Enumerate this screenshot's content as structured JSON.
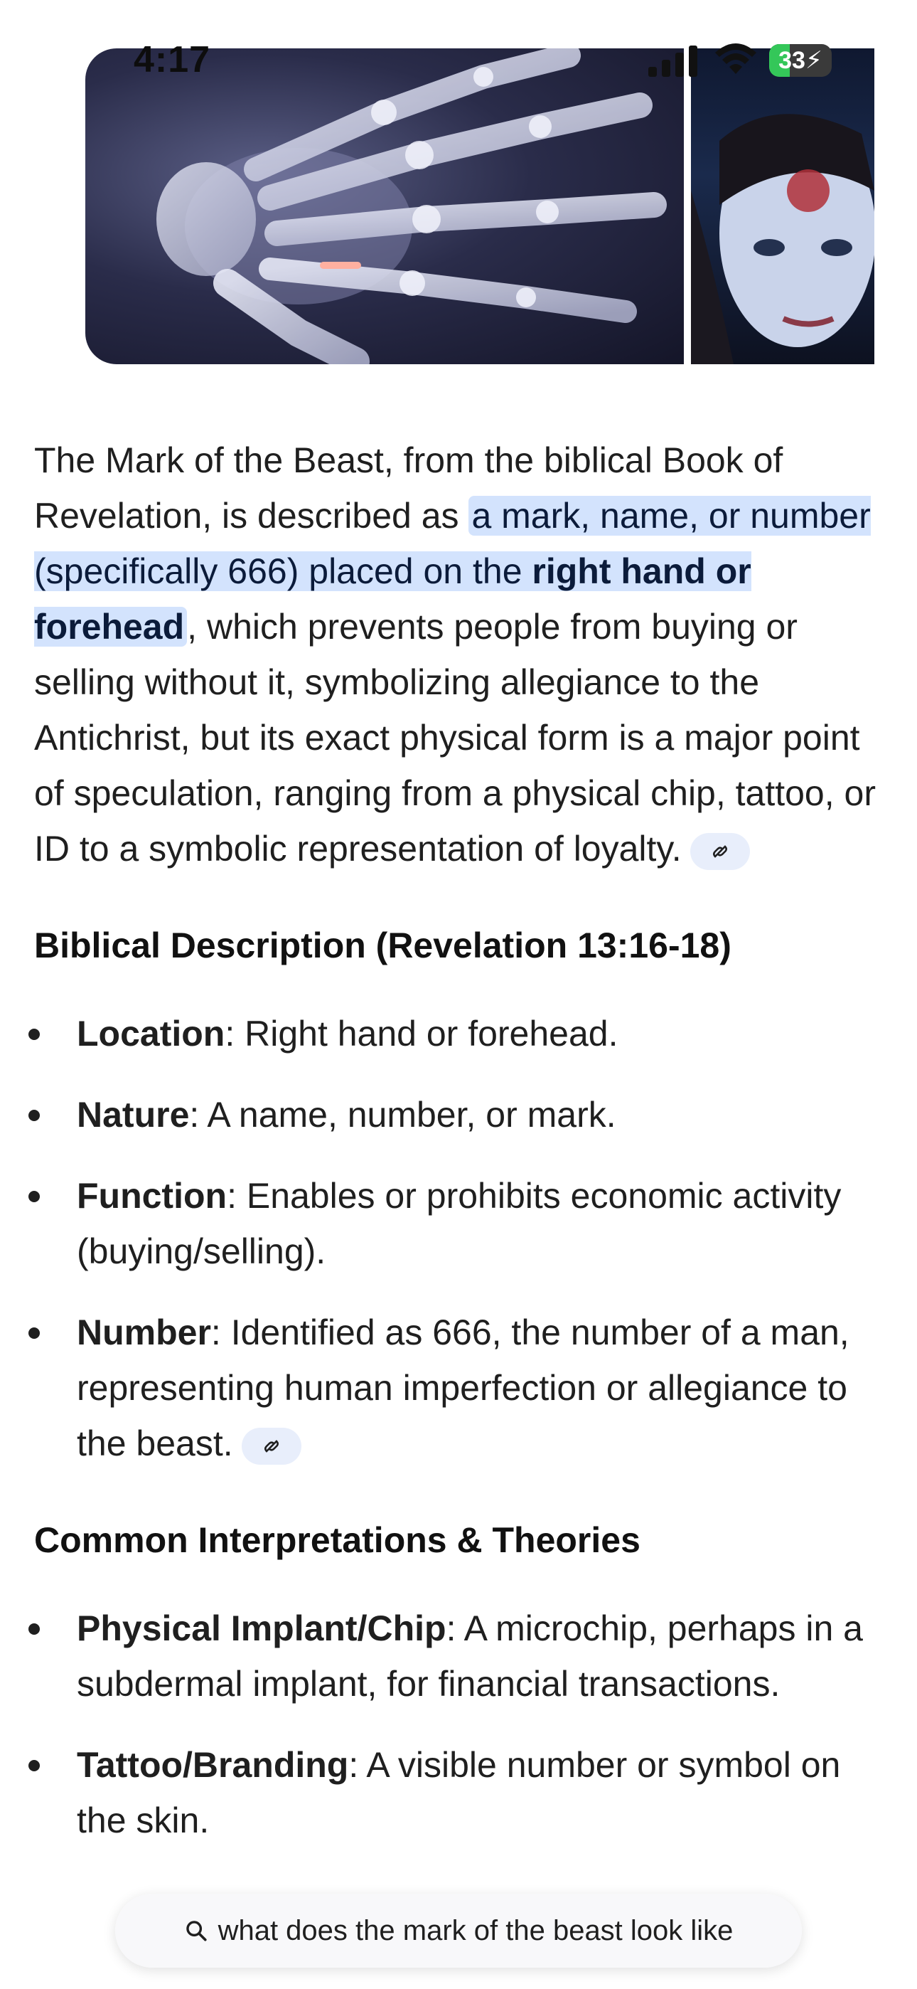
{
  "status_bar": {
    "time": "4:17",
    "battery": "33",
    "battery_level": 0.33
  },
  "images": [
    {
      "alt": "x-ray-hand-with-implant"
    },
    {
      "alt": "woman-with-mark-on-forehead"
    }
  ],
  "intro": {
    "before": "The Mark of the Beast, from the biblical Book of Revelation, is described as ",
    "highlight_a": "a mark, name, or number (specifically 666) placed on the ",
    "highlight_b": "right hand or forehead",
    "after": ", which prevents people from buying or selling without it, symbolizing allegiance to the Antichrist, but its exact physical form is a major point of speculation, ranging from a physical chip, tattoo, or ID to a symbolic representation of loyalty."
  },
  "section1": {
    "heading": "Biblical Description (Revelation 13:16-18)",
    "items": [
      {
        "term": "Location",
        "text": ": Right hand or forehead."
      },
      {
        "term": "Nature",
        "text": ": A name, number, or mark."
      },
      {
        "term": "Function",
        "text": ": Enables or prohibits economic activity (buying/selling)."
      },
      {
        "term": "Number",
        "text": ": Identified as 666, the number of a man, representing human imperfection or allegiance to the beast."
      }
    ]
  },
  "section2": {
    "heading": "Common Interpretations & Theories",
    "items": [
      {
        "term": "Physical Implant/Chip",
        "text": ": A microchip, perhaps in a subdermal implant, for financial transactions."
      },
      {
        "term": "Tattoo/Branding",
        "text": ": A visible number or symbol on the skin."
      }
    ]
  },
  "search": {
    "query": "what does the mark of the beast look like"
  },
  "colors": {
    "highlight": "#d3e3fd",
    "link_chip": "#e8eefb",
    "battery_green": "#34c759"
  }
}
